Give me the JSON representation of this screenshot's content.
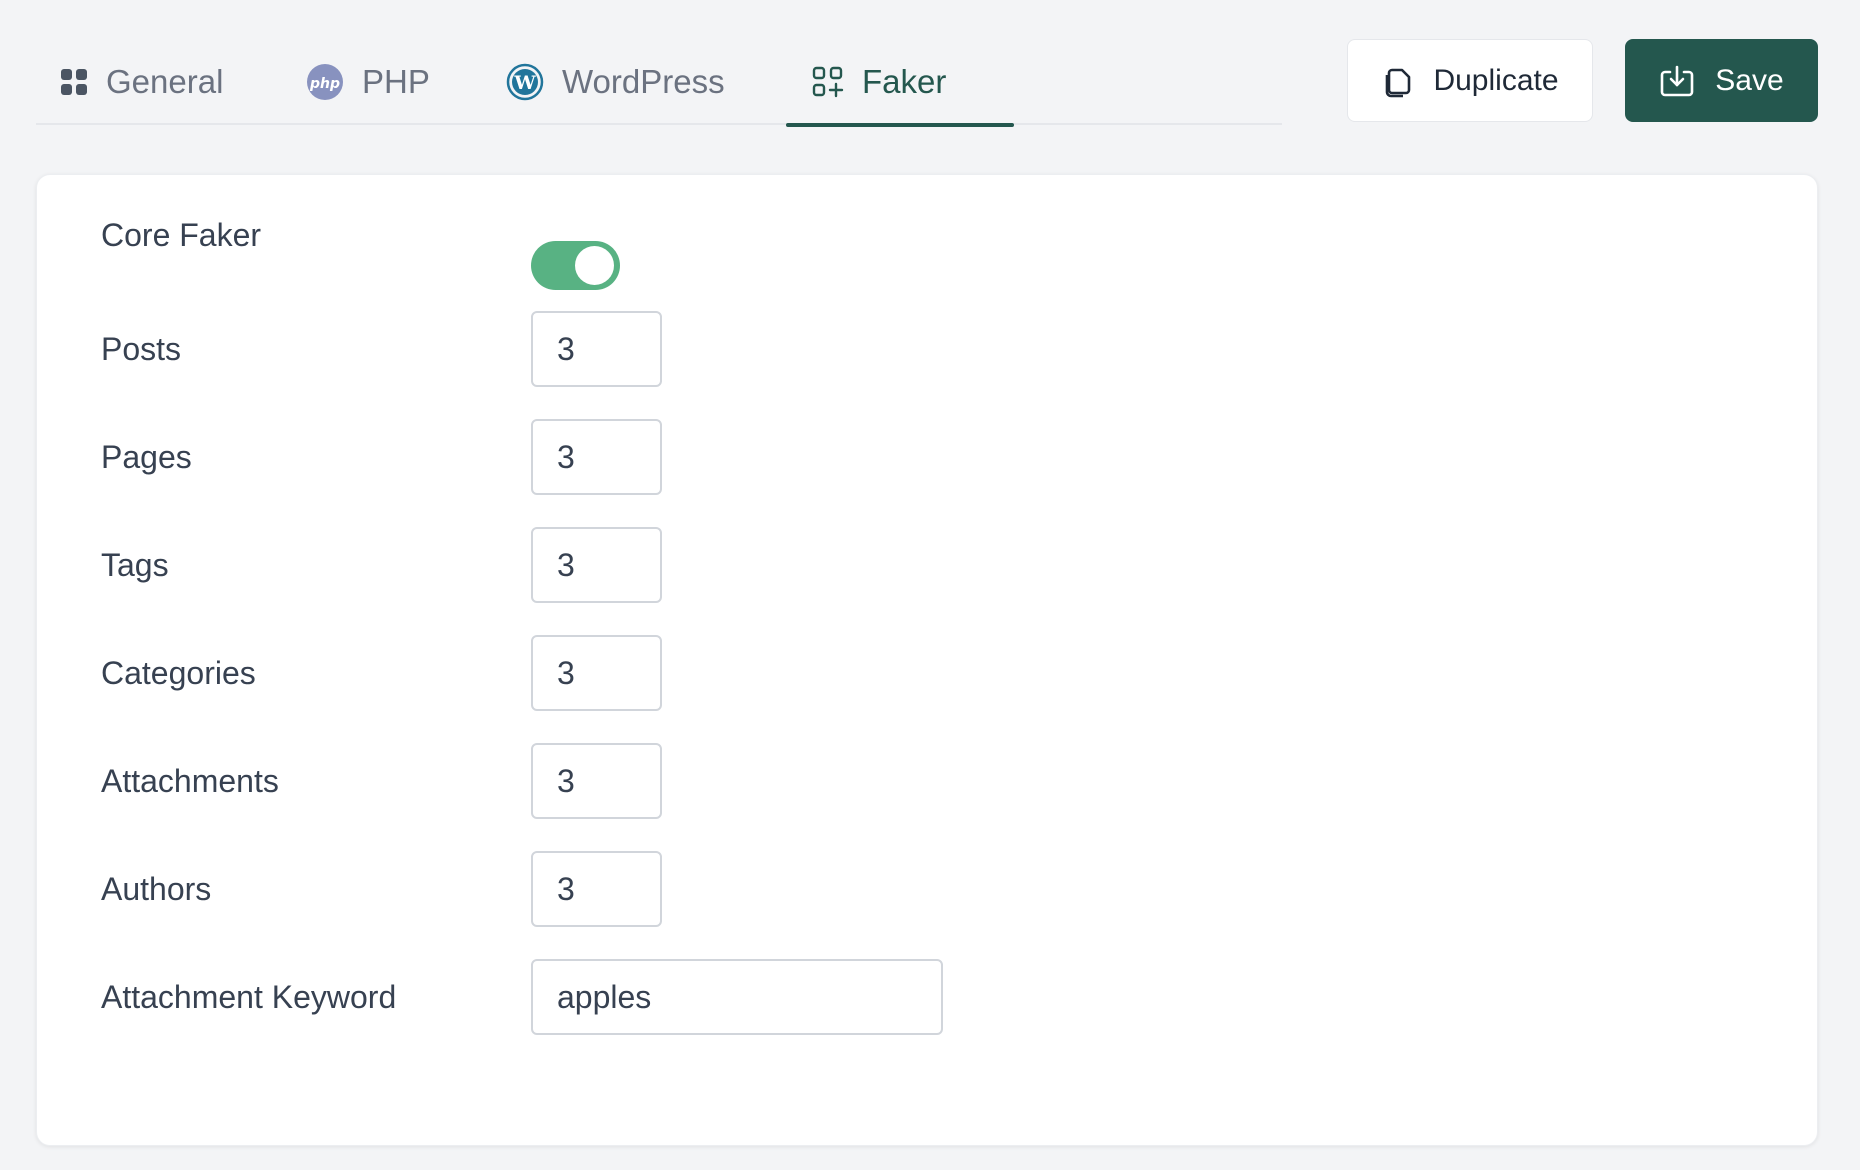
{
  "tabs": [
    {
      "label": "General",
      "icon": "grid-icon",
      "active": false
    },
    {
      "label": "PHP",
      "icon": "php-logo-icon",
      "active": false
    },
    {
      "label": "WordPress",
      "icon": "wordpress-logo-icon",
      "active": false
    },
    {
      "label": "Faker",
      "icon": "apps-add-icon",
      "active": true
    }
  ],
  "actions": {
    "duplicate_label": "Duplicate",
    "save_label": "Save"
  },
  "colors": {
    "accent": "#24574e",
    "toggle_on": "#58b283",
    "php_logo": "#8892bf",
    "wordpress_logo": "#21759b"
  },
  "form": {
    "core_faker": {
      "label": "Core Faker",
      "enabled": true
    },
    "fields": [
      {
        "label": "Posts",
        "value": "3"
      },
      {
        "label": "Pages",
        "value": "3"
      },
      {
        "label": "Tags",
        "value": "3"
      },
      {
        "label": "Categories",
        "value": "3"
      },
      {
        "label": "Attachments",
        "value": "3"
      },
      {
        "label": "Authors",
        "value": "3"
      }
    ],
    "attachment_keyword": {
      "label": "Attachment Keyword",
      "value": "apples"
    }
  }
}
